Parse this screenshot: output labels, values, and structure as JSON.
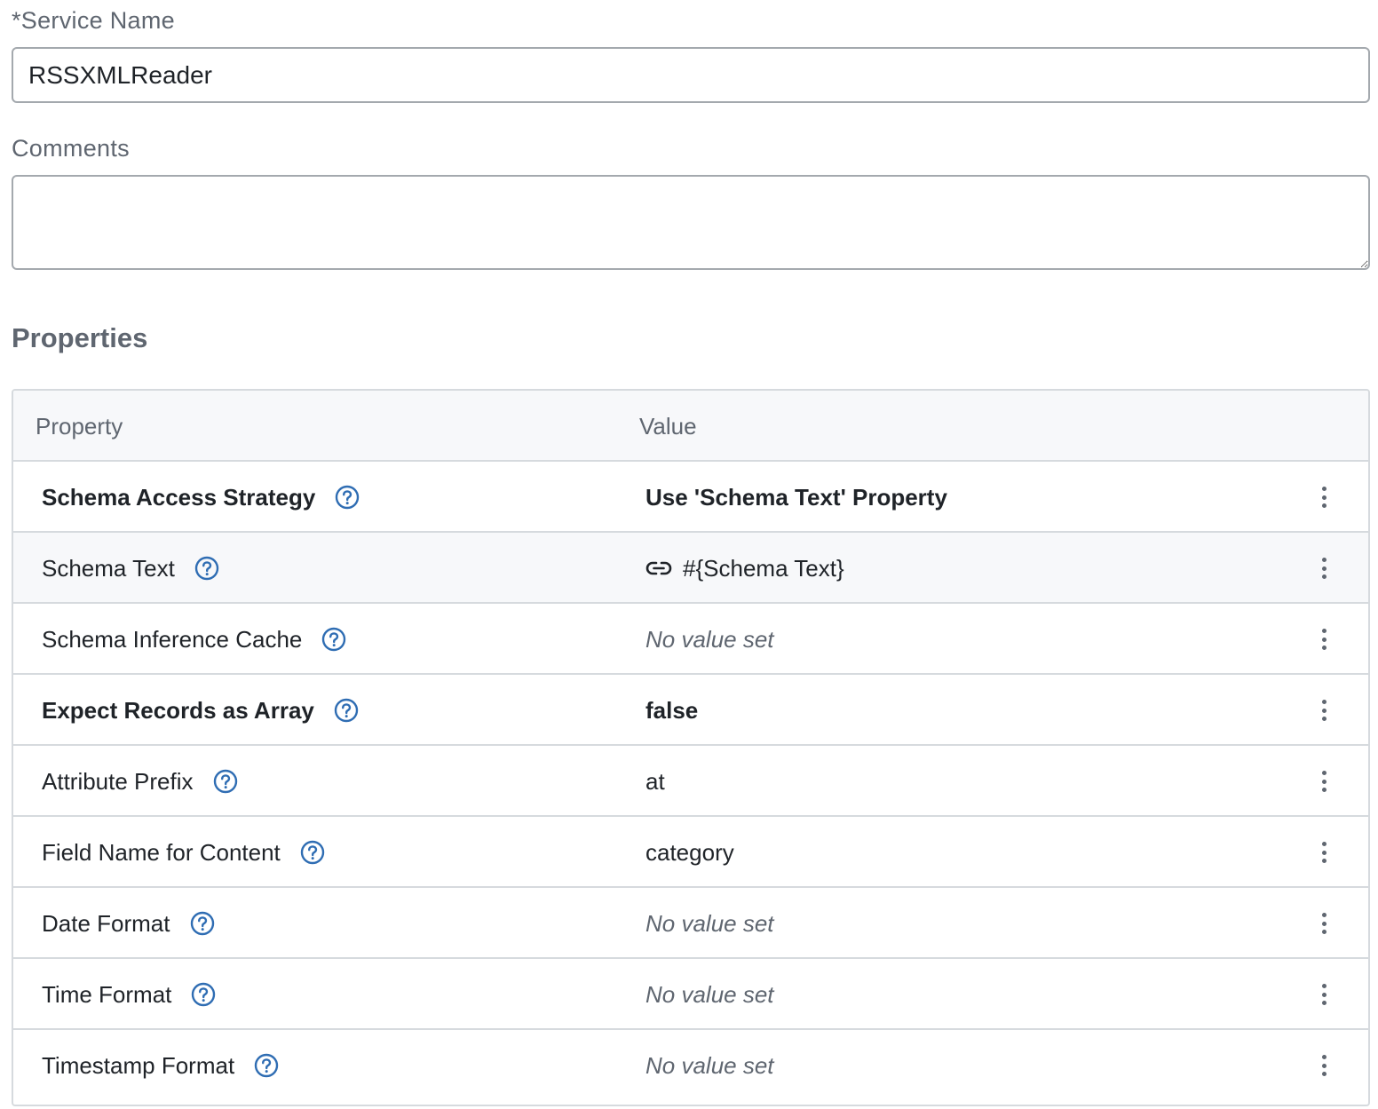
{
  "form": {
    "service_name_label": "*Service Name",
    "service_name_value": "RSSXMLReader",
    "comments_label": "Comments",
    "comments_value": ""
  },
  "properties": {
    "section_title": "Properties",
    "columns": {
      "property": "Property",
      "value": "Value"
    },
    "rows": [
      {
        "name": "Schema Access Strategy",
        "value": "Use 'Schema Text' Property",
        "required": true,
        "value_state": "set"
      },
      {
        "name": "Schema Text",
        "value": "#{Schema Text}",
        "required": false,
        "value_state": "parameter"
      },
      {
        "name": "Schema Inference Cache",
        "value": "No value set",
        "required": false,
        "value_state": "empty"
      },
      {
        "name": "Expect Records as Array",
        "value": "false",
        "required": true,
        "value_state": "set"
      },
      {
        "name": "Attribute Prefix",
        "value": "at",
        "required": false,
        "value_state": "set"
      },
      {
        "name": "Field Name for Content",
        "value": "category",
        "required": false,
        "value_state": "set"
      },
      {
        "name": "Date Format",
        "value": "No value set",
        "required": false,
        "value_state": "empty"
      },
      {
        "name": "Time Format",
        "value": "No value set",
        "required": false,
        "value_state": "empty"
      },
      {
        "name": "Timestamp Format",
        "value": "No value set",
        "required": false,
        "value_state": "empty"
      }
    ]
  },
  "icons": {
    "help": "help-circle-icon",
    "parameter_link": "link-icon",
    "row_menu": "more-vertical-icon"
  },
  "colors": {
    "help_icon": "#2f6db3",
    "border": "#d6dade",
    "header_bg": "#f7f8fa",
    "muted_text": "#5f6670"
  }
}
